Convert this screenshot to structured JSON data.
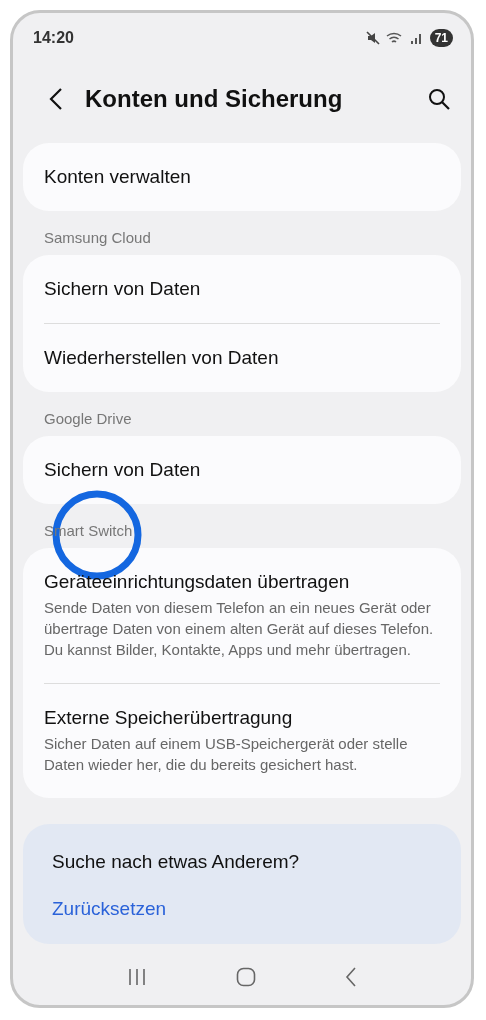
{
  "status_bar": {
    "time": "14:20",
    "battery": "71"
  },
  "header": {
    "title": "Konten und Sicherung"
  },
  "sections": [
    {
      "items": [
        {
          "title": "Konten verwalten"
        }
      ]
    },
    {
      "label": "Samsung Cloud",
      "items": [
        {
          "title": "Sichern von Daten"
        },
        {
          "title": "Wiederherstellen von Daten"
        }
      ]
    },
    {
      "label": "Google Drive",
      "items": [
        {
          "title": "Sichern von Daten"
        }
      ]
    },
    {
      "label": "Smart Switch",
      "items": [
        {
          "title": "Geräteeinrichtungsdaten übertragen",
          "description": "Sende Daten von diesem Telefon an ein neues Gerät oder übertrage Daten von einem alten Gerät auf dieses Telefon. Du kannst Bilder, Kontakte, Apps und mehr übertragen."
        },
        {
          "title": "Externe Speicherübertragung",
          "description": "Sicher Daten auf einem USB-Speichergerät oder stelle Daten wieder her, die du bereits gesichert hast."
        }
      ]
    }
  ],
  "suggestions": {
    "title": "Suche nach etwas Anderem?",
    "links": [
      "Zurücksetzen"
    ]
  }
}
